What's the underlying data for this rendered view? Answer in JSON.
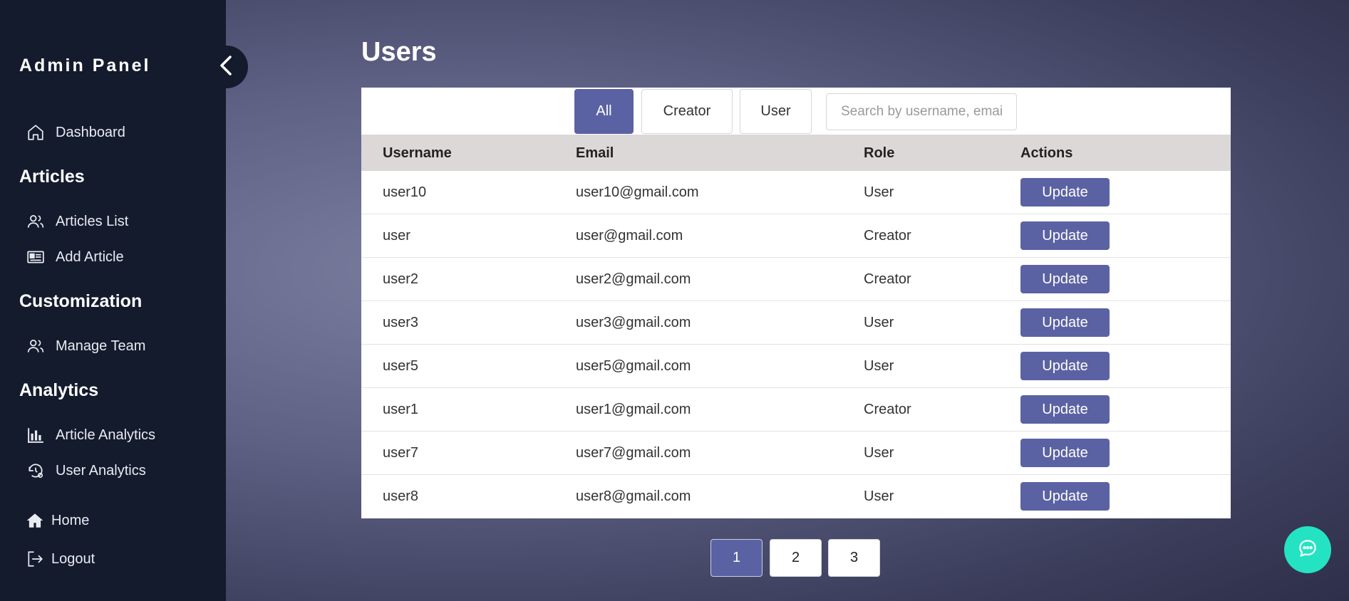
{
  "sidebar": {
    "brand": "Admin Panel",
    "dashboard": "Dashboard",
    "sections": {
      "articles": "Articles",
      "customization": "Customization",
      "analytics": "Analytics"
    },
    "articles_list": "Articles List",
    "add_article": "Add Article",
    "manage_team": "Manage Team",
    "article_analytics": "Article Analytics",
    "user_analytics": "User Analytics",
    "home": "Home",
    "logout": "Logout"
  },
  "main": {
    "title": "Users",
    "filters": [
      "All",
      "Creator",
      "User"
    ],
    "active_filter": "All",
    "search_placeholder": "Search by username, email",
    "columns": [
      "Username",
      "Email",
      "Role",
      "Actions"
    ],
    "rows": [
      {
        "username": "user10",
        "email": "user10@gmail.com",
        "role": "User",
        "action": "Update"
      },
      {
        "username": "user",
        "email": "user@gmail.com",
        "role": "Creator",
        "action": "Update"
      },
      {
        "username": "user2",
        "email": "user2@gmail.com",
        "role": "Creator",
        "action": "Update"
      },
      {
        "username": "user3",
        "email": "user3@gmail.com",
        "role": "User",
        "action": "Update"
      },
      {
        "username": "user5",
        "email": "user5@gmail.com",
        "role": "User",
        "action": "Update"
      },
      {
        "username": "user1",
        "email": "user1@gmail.com",
        "role": "Creator",
        "action": "Update"
      },
      {
        "username": "user7",
        "email": "user7@gmail.com",
        "role": "User",
        "action": "Update"
      },
      {
        "username": "user8",
        "email": "user8@gmail.com",
        "role": "User",
        "action": "Update"
      }
    ],
    "pagination": [
      "1",
      "2",
      "3"
    ],
    "current_page": "1"
  },
  "colors": {
    "sidebar_bg": "#141b2d",
    "accent": "#5b62a3",
    "chat_fab": "#24e3c2",
    "table_header_bg": "#dcd8d8"
  },
  "icons": {
    "collapse": "chevron-left-icon",
    "dashboard": "home-outline-icon",
    "articles_list": "people-outline-icon",
    "add_article": "newspaper-icon",
    "manage_team": "people-outline-icon",
    "article_analytics": "bar-chart-icon",
    "user_analytics": "history-gear-icon",
    "home": "home-solid-icon",
    "logout": "logout-icon",
    "chat": "chat-bubble-icon"
  }
}
